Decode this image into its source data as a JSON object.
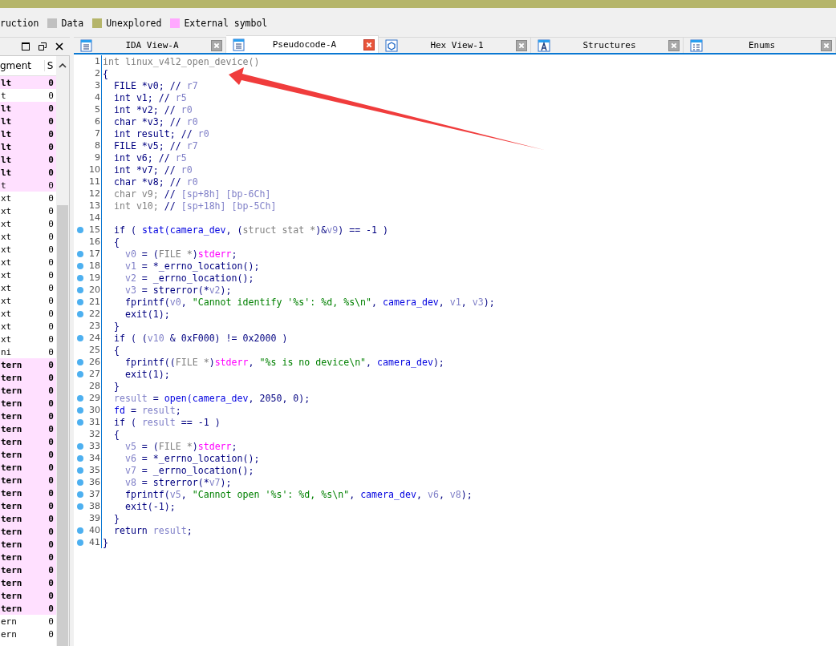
{
  "legend": [
    {
      "label": "ruction"
    },
    {
      "label": "Data",
      "color": "#c0c0c0"
    },
    {
      "label": "Unexplored",
      "color": "#b5b56a"
    },
    {
      "label": "External symbol",
      "color": "#ffa8ff"
    }
  ],
  "left_panel": {
    "columns": [
      "gment",
      "S"
    ],
    "rows": [
      {
        "cells": [
          "lt",
          "0"
        ],
        "highlighted": true,
        "bold": true
      },
      {
        "cells": [
          "t",
          "0"
        ],
        "highlighted": false,
        "bold": false
      },
      {
        "cells": [
          "lt",
          "0"
        ],
        "highlighted": true,
        "bold": true
      },
      {
        "cells": [
          "lt",
          "0"
        ],
        "highlighted": true,
        "bold": true
      },
      {
        "cells": [
          "lt",
          "0"
        ],
        "highlighted": true,
        "bold": true
      },
      {
        "cells": [
          "lt",
          "0"
        ],
        "highlighted": true,
        "bold": true
      },
      {
        "cells": [
          "lt",
          "0"
        ],
        "highlighted": true,
        "bold": true
      },
      {
        "cells": [
          "lt",
          "0"
        ],
        "highlighted": true,
        "bold": true
      },
      {
        "cells": [
          "t",
          "0"
        ],
        "highlighted": true,
        "bold": false
      },
      {
        "cells": [
          "xt",
          "0"
        ],
        "highlighted": false,
        "bold": false
      },
      {
        "cells": [
          "xt",
          "0"
        ],
        "highlighted": false,
        "bold": false
      },
      {
        "cells": [
          "xt",
          "0"
        ],
        "highlighted": false,
        "bold": false
      },
      {
        "cells": [
          "xt",
          "0"
        ],
        "highlighted": false,
        "bold": false
      },
      {
        "cells": [
          "xt",
          "0"
        ],
        "highlighted": false,
        "bold": false
      },
      {
        "cells": [
          "xt",
          "0"
        ],
        "highlighted": false,
        "bold": false
      },
      {
        "cells": [
          "xt",
          "0"
        ],
        "highlighted": false,
        "bold": false
      },
      {
        "cells": [
          "xt",
          "0"
        ],
        "highlighted": false,
        "bold": false
      },
      {
        "cells": [
          "xt",
          "0"
        ],
        "highlighted": false,
        "bold": false
      },
      {
        "cells": [
          "xt",
          "0"
        ],
        "highlighted": false,
        "bold": false
      },
      {
        "cells": [
          "xt",
          "0"
        ],
        "highlighted": false,
        "bold": false
      },
      {
        "cells": [
          "xt",
          "0"
        ],
        "highlighted": false,
        "bold": false
      },
      {
        "cells": [
          "ni",
          "0"
        ],
        "highlighted": false,
        "bold": false
      },
      {
        "cells": [
          "tern",
          "0"
        ],
        "highlighted": true,
        "bold": true
      },
      {
        "cells": [
          "tern",
          "0"
        ],
        "highlighted": true,
        "bold": true
      },
      {
        "cells": [
          "tern",
          "0"
        ],
        "highlighted": true,
        "bold": true
      },
      {
        "cells": [
          "tern",
          "0"
        ],
        "highlighted": true,
        "bold": true
      },
      {
        "cells": [
          "tern",
          "0"
        ],
        "highlighted": true,
        "bold": true
      },
      {
        "cells": [
          "tern",
          "0"
        ],
        "highlighted": true,
        "bold": true
      },
      {
        "cells": [
          "tern",
          "0"
        ],
        "highlighted": true,
        "bold": true
      },
      {
        "cells": [
          "tern",
          "0"
        ],
        "highlighted": true,
        "bold": true
      },
      {
        "cells": [
          "tern",
          "0"
        ],
        "highlighted": true,
        "bold": true
      },
      {
        "cells": [
          "tern",
          "0"
        ],
        "highlighted": true,
        "bold": true
      },
      {
        "cells": [
          "tern",
          "0"
        ],
        "highlighted": true,
        "bold": true
      },
      {
        "cells": [
          "tern",
          "0"
        ],
        "highlighted": true,
        "bold": true
      },
      {
        "cells": [
          "tern",
          "0"
        ],
        "highlighted": true,
        "bold": true
      },
      {
        "cells": [
          "tern",
          "0"
        ],
        "highlighted": true,
        "bold": true
      },
      {
        "cells": [
          "tern",
          "0"
        ],
        "highlighted": true,
        "bold": true
      },
      {
        "cells": [
          "tern",
          "0"
        ],
        "highlighted": true,
        "bold": true
      },
      {
        "cells": [
          "tern",
          "0"
        ],
        "highlighted": true,
        "bold": true
      },
      {
        "cells": [
          "tern",
          "0"
        ],
        "highlighted": true,
        "bold": true
      },
      {
        "cells": [
          "tern",
          "0"
        ],
        "highlighted": true,
        "bold": true
      },
      {
        "cells": [
          "tern",
          "0"
        ],
        "highlighted": true,
        "bold": true
      },
      {
        "cells": [
          "ern",
          "0"
        ],
        "highlighted": false,
        "bold": false
      },
      {
        "cells": [
          "ern",
          "0"
        ],
        "highlighted": false,
        "bold": false
      }
    ]
  },
  "tabs": [
    {
      "label": "IDA View-A",
      "kind": "disassembly",
      "selected": false
    },
    {
      "label": "Pseudocode-A",
      "kind": "pseudocode",
      "selected": true
    },
    {
      "label": "Hex View-1",
      "kind": "hex",
      "selected": false
    },
    {
      "label": "Structures",
      "kind": "structures",
      "selected": false
    },
    {
      "label": "Enums",
      "kind": "enums",
      "selected": false
    }
  ],
  "code": {
    "lines": [
      {
        "number": "1",
        "marked": false,
        "tokens": [
          {
            "kind": "muted",
            "text": "int linux_v4l2_open_device()"
          }
        ]
      },
      {
        "number": "2",
        "marked": false,
        "tokens": [
          {
            "kind": "plain",
            "text": "{"
          }
        ]
      },
      {
        "number": "3",
        "marked": false,
        "tokens": [
          {
            "kind": "plain",
            "text": "  FILE *v0; // "
          },
          {
            "kind": "local",
            "text": "r7"
          }
        ]
      },
      {
        "number": "4",
        "marked": false,
        "tokens": [
          {
            "kind": "plain",
            "text": "  int v1; // "
          },
          {
            "kind": "local",
            "text": "r5"
          }
        ]
      },
      {
        "number": "5",
        "marked": false,
        "tokens": [
          {
            "kind": "plain",
            "text": "  int *v2; // "
          },
          {
            "kind": "local",
            "text": "r0"
          }
        ]
      },
      {
        "number": "6",
        "marked": false,
        "tokens": [
          {
            "kind": "plain",
            "text": "  char *v3; // "
          },
          {
            "kind": "local",
            "text": "r0"
          }
        ]
      },
      {
        "number": "7",
        "marked": false,
        "tokens": [
          {
            "kind": "plain",
            "text": "  int result; // "
          },
          {
            "kind": "local",
            "text": "r0"
          }
        ]
      },
      {
        "number": "8",
        "marked": false,
        "tokens": [
          {
            "kind": "plain",
            "text": "  FILE *v5; // "
          },
          {
            "kind": "local",
            "text": "r7"
          }
        ]
      },
      {
        "number": "9",
        "marked": false,
        "tokens": [
          {
            "kind": "plain",
            "text": "  int v6; // "
          },
          {
            "kind": "local",
            "text": "r5"
          }
        ]
      },
      {
        "number": "10",
        "marked": false,
        "tokens": [
          {
            "kind": "plain",
            "text": "  int *v7; // "
          },
          {
            "kind": "local",
            "text": "r0"
          }
        ]
      },
      {
        "number": "11",
        "marked": false,
        "tokens": [
          {
            "kind": "plain",
            "text": "  char *v8; // "
          },
          {
            "kind": "local",
            "text": "r0"
          }
        ]
      },
      {
        "number": "12",
        "marked": false,
        "tokens": [
          {
            "kind": "muted",
            "text": "  char v9; "
          },
          {
            "kind": "plain",
            "text": "// "
          },
          {
            "kind": "local",
            "text": "[sp+8h] [bp-6Ch]"
          }
        ]
      },
      {
        "number": "13",
        "marked": false,
        "tokens": [
          {
            "kind": "muted",
            "text": "  int v10; "
          },
          {
            "kind": "plain",
            "text": "// "
          },
          {
            "kind": "local",
            "text": "[sp+18h] [bp-5Ch]"
          }
        ]
      },
      {
        "number": "14",
        "marked": false
      },
      {
        "number": "15",
        "marked": true,
        "tokens": [
          {
            "kind": "plain",
            "text": "  if ( "
          },
          {
            "kind": "name",
            "text": "stat(camera_dev"
          },
          {
            "kind": "plain",
            "text": ", ("
          },
          {
            "kind": "muted",
            "text": "struct stat *"
          },
          {
            "kind": "plain",
            "text": ")&"
          },
          {
            "kind": "local",
            "text": "v9"
          },
          {
            "kind": "plain",
            "text": ") == -1 )"
          }
        ]
      },
      {
        "number": "16",
        "marked": false,
        "tokens": [
          {
            "kind": "plain",
            "text": "  {"
          }
        ]
      },
      {
        "number": "17",
        "marked": true,
        "tokens": [
          {
            "kind": "local",
            "text": "    v0"
          },
          {
            "kind": "plain",
            "text": " = ("
          },
          {
            "kind": "muted",
            "text": "FILE *"
          },
          {
            "kind": "plain",
            "text": ")"
          },
          {
            "kind": "import",
            "text": "stderr"
          },
          {
            "kind": "plain",
            "text": ";"
          }
        ]
      },
      {
        "number": "18",
        "marked": true,
        "tokens": [
          {
            "kind": "local",
            "text": "    v1"
          },
          {
            "kind": "plain",
            "text": " = *_errno_location();"
          }
        ]
      },
      {
        "number": "19",
        "marked": true,
        "tokens": [
          {
            "kind": "local",
            "text": "    v2"
          },
          {
            "kind": "plain",
            "text": " = _errno_location();"
          }
        ]
      },
      {
        "number": "20",
        "marked": true,
        "tokens": [
          {
            "kind": "local",
            "text": "    v3"
          },
          {
            "kind": "plain",
            "text": " = strerror(*"
          },
          {
            "kind": "local",
            "text": "v2"
          },
          {
            "kind": "plain",
            "text": ");"
          }
        ]
      },
      {
        "number": "21",
        "marked": true,
        "tokens": [
          {
            "kind": "plain",
            "text": "    fprintf("
          },
          {
            "kind": "local",
            "text": "v0"
          },
          {
            "kind": "plain",
            "text": ", "
          },
          {
            "kind": "string",
            "text": "\"Cannot identify '%s': %d, %s\\n\""
          },
          {
            "kind": "plain",
            "text": ", "
          },
          {
            "kind": "name",
            "text": "camera_dev"
          },
          {
            "kind": "plain",
            "text": ", "
          },
          {
            "kind": "local",
            "text": "v1"
          },
          {
            "kind": "plain",
            "text": ", "
          },
          {
            "kind": "local",
            "text": "v3"
          },
          {
            "kind": "plain",
            "text": ");"
          }
        ]
      },
      {
        "number": "22",
        "marked": true,
        "tokens": [
          {
            "kind": "plain",
            "text": "    exit(1);"
          }
        ]
      },
      {
        "number": "23",
        "marked": false,
        "tokens": [
          {
            "kind": "plain",
            "text": "  }"
          }
        ]
      },
      {
        "number": "24",
        "marked": true,
        "tokens": [
          {
            "kind": "plain",
            "text": "  if ( ("
          },
          {
            "kind": "local",
            "text": "v10"
          },
          {
            "kind": "plain",
            "text": " & 0xF000) != 0x2000 )"
          }
        ]
      },
      {
        "number": "25",
        "marked": false,
        "tokens": [
          {
            "kind": "plain",
            "text": "  {"
          }
        ]
      },
      {
        "number": "26",
        "marked": true,
        "tokens": [
          {
            "kind": "plain",
            "text": "    fprintf(("
          },
          {
            "kind": "muted",
            "text": "FILE *"
          },
          {
            "kind": "plain",
            "text": ")"
          },
          {
            "kind": "import",
            "text": "stderr"
          },
          {
            "kind": "plain",
            "text": ", "
          },
          {
            "kind": "string",
            "text": "\"%s is no device\\n\""
          },
          {
            "kind": "plain",
            "text": ", "
          },
          {
            "kind": "name",
            "text": "camera_dev"
          },
          {
            "kind": "plain",
            "text": ");"
          }
        ]
      },
      {
        "number": "27",
        "marked": true,
        "tokens": [
          {
            "kind": "plain",
            "text": "    exit(1);"
          }
        ]
      },
      {
        "number": "28",
        "marked": false,
        "tokens": [
          {
            "kind": "plain",
            "text": "  }"
          }
        ]
      },
      {
        "number": "29",
        "marked": true,
        "tokens": [
          {
            "kind": "local",
            "text": "  result"
          },
          {
            "kind": "plain",
            "text": " = "
          },
          {
            "kind": "name",
            "text": "open(camera_dev"
          },
          {
            "kind": "plain",
            "text": ", 2050, 0);"
          }
        ]
      },
      {
        "number": "30",
        "marked": true,
        "tokens": [
          {
            "kind": "name",
            "text": "  fd"
          },
          {
            "kind": "plain",
            "text": " = "
          },
          {
            "kind": "local",
            "text": "result"
          },
          {
            "kind": "plain",
            "text": ";"
          }
        ]
      },
      {
        "number": "31",
        "marked": true,
        "tokens": [
          {
            "kind": "plain",
            "text": "  if ( "
          },
          {
            "kind": "local",
            "text": "result"
          },
          {
            "kind": "plain",
            "text": " == -1 )"
          }
        ]
      },
      {
        "number": "32",
        "marked": false,
        "tokens": [
          {
            "kind": "plain",
            "text": "  {"
          }
        ]
      },
      {
        "number": "33",
        "marked": true,
        "tokens": [
          {
            "kind": "local",
            "text": "    v5"
          },
          {
            "kind": "plain",
            "text": " = ("
          },
          {
            "kind": "muted",
            "text": "FILE *"
          },
          {
            "kind": "plain",
            "text": ")"
          },
          {
            "kind": "import",
            "text": "stderr"
          },
          {
            "kind": "plain",
            "text": ";"
          }
        ]
      },
      {
        "number": "34",
        "marked": true,
        "tokens": [
          {
            "kind": "local",
            "text": "    v6"
          },
          {
            "kind": "plain",
            "text": " = *_errno_location();"
          }
        ]
      },
      {
        "number": "35",
        "marked": true,
        "tokens": [
          {
            "kind": "local",
            "text": "    v7"
          },
          {
            "kind": "plain",
            "text": " = _errno_location();"
          }
        ]
      },
      {
        "number": "36",
        "marked": true,
        "tokens": [
          {
            "kind": "local",
            "text": "    v8"
          },
          {
            "kind": "plain",
            "text": " = strerror(*"
          },
          {
            "kind": "local",
            "text": "v7"
          },
          {
            "kind": "plain",
            "text": ");"
          }
        ]
      },
      {
        "number": "37",
        "marked": true,
        "tokens": [
          {
            "kind": "plain",
            "text": "    fprintf("
          },
          {
            "kind": "local",
            "text": "v5"
          },
          {
            "kind": "plain",
            "text": ", "
          },
          {
            "kind": "string",
            "text": "\"Cannot open '%s': %d, %s\\n\""
          },
          {
            "kind": "plain",
            "text": ", "
          },
          {
            "kind": "name",
            "text": "camera_dev"
          },
          {
            "kind": "plain",
            "text": ", "
          },
          {
            "kind": "local",
            "text": "v6"
          },
          {
            "kind": "plain",
            "text": ", "
          },
          {
            "kind": "local",
            "text": "v8"
          },
          {
            "kind": "plain",
            "text": ");"
          }
        ]
      },
      {
        "number": "38",
        "marked": true,
        "tokens": [
          {
            "kind": "plain",
            "text": "    exit(-1);"
          }
        ]
      },
      {
        "number": "39",
        "marked": false,
        "tokens": [
          {
            "kind": "plain",
            "text": "  }"
          }
        ]
      },
      {
        "number": "40",
        "marked": true,
        "tokens": [
          {
            "kind": "plain",
            "text": "  return "
          },
          {
            "kind": "local",
            "text": "result"
          },
          {
            "kind": "plain",
            "text": ";"
          }
        ]
      },
      {
        "number": "41",
        "marked": true,
        "tokens": [
          {
            "kind": "plain",
            "text": "}"
          }
        ]
      }
    ]
  }
}
